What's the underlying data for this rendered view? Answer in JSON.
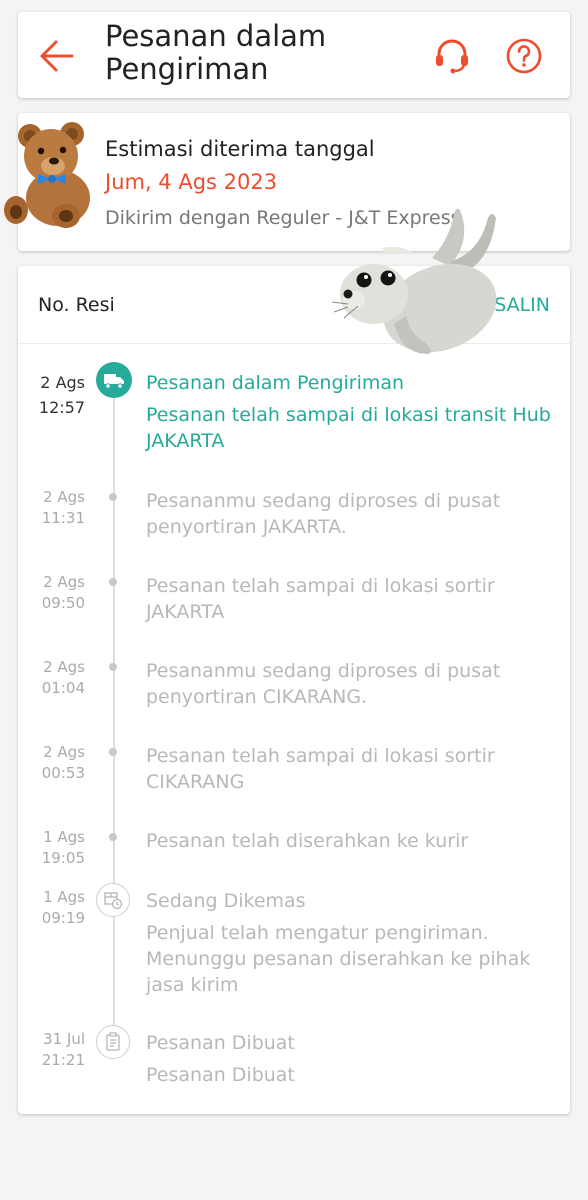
{
  "header": {
    "title": "Pesanan dalam Pengiriman"
  },
  "estimate": {
    "label": "Estimasi diterima tanggal",
    "date": "Jum, 4 Ags 2023",
    "courier": "Dikirim dengan Reguler - J&T Express"
  },
  "tracking": {
    "resi_label": "No. Resi",
    "copy_label": "SALIN",
    "events": [
      {
        "day": "2 Ags",
        "time": "12:57",
        "text": "Pesanan dalam Pengiriman",
        "sub": "Pesanan telah sampai di lokasi transit Hub JAKARTA"
      },
      {
        "day": "2 Ags",
        "time": "11:31",
        "text": "Pesananmu sedang diproses di pusat penyortiran JAKARTA."
      },
      {
        "day": "2 Ags",
        "time": "09:50",
        "text": "Pesanan telah sampai di lokasi sortir JAKARTA"
      },
      {
        "day": "2 Ags",
        "time": "01:04",
        "text": "Pesananmu sedang diproses di pusat penyortiran CIKARANG."
      },
      {
        "day": "2 Ags",
        "time": "00:53",
        "text": "Pesanan telah sampai di lokasi sortir CIKARANG"
      },
      {
        "day": "1 Ags",
        "time": "19:05",
        "text": "Pesanan telah diserahkan ke kurir"
      },
      {
        "day": "1 Ags",
        "time": "09:19",
        "text": "Sedang Dikemas",
        "sub": "Penjual telah mengatur pengiriman. Menunggu pesanan diserahkan ke pihak jasa kirim"
      },
      {
        "day": "31 Jul",
        "time": "21:21",
        "text": "Pesanan Dibuat",
        "sub": "Pesanan Dibuat"
      }
    ]
  },
  "icons": {
    "back": "arrow-left-icon",
    "support": "headset-icon",
    "help": "question-circle-icon",
    "truck": "truck-icon",
    "package": "package-clock-icon",
    "receipt": "receipt-icon",
    "teddy": "teddy-bear-sticker",
    "seal": "seal-sticker"
  },
  "colors": {
    "accent": "#ee4d2d",
    "teal": "#26aa99",
    "muted": "#b8b8b8"
  }
}
